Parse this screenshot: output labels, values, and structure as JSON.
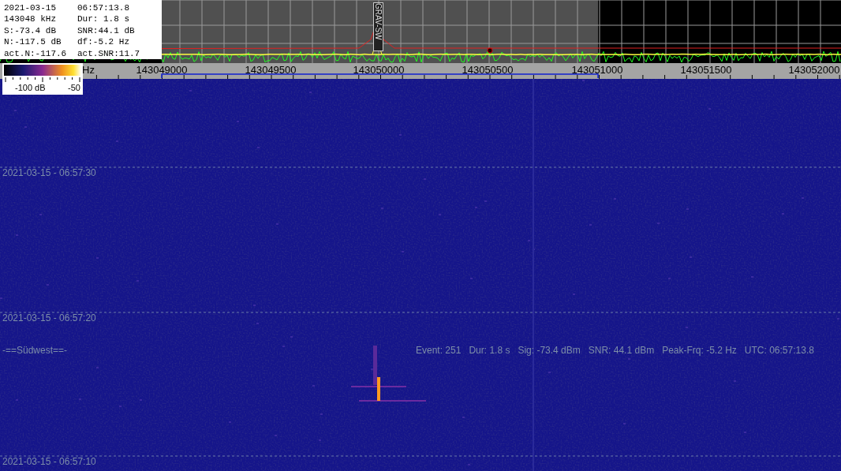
{
  "info": {
    "rows": [
      [
        "2021-03-15",
        "06:57:13.8"
      ],
      [
        "143048 kHz",
        "Dur: 1.8 s"
      ],
      [
        "S:-73.4 dB",
        "SNR:44.1 dB"
      ],
      [
        "N:-117.5 dB",
        "df:-5.2 Hz"
      ],
      [
        "act.N:-117.6",
        "act.SNR:11.7"
      ]
    ]
  },
  "legend": {
    "labels": [
      "-100 dB",
      "-50"
    ]
  },
  "spectrum": {
    "marker": "GRAV-SW"
  },
  "scale": {
    "unit": "Hz",
    "labels": [
      "143049000",
      "143049500",
      "143050000",
      "143050500",
      "143051000",
      "143051500",
      "143052000"
    ]
  },
  "waterfall": {
    "time_labels": [
      "2021-03-15 - 06:57:30",
      "2021-03-15 - 06:57:20",
      "2021-03-15 - 06:57:10"
    ],
    "station": "-==Südwest==-",
    "event": "Event: 251   Dur: 1.8 s   Sig: -73.4 dBm   SNR: 44.1 dBm   Peak-Frq: -5.2 Hz   UTC: 06:57:13.8"
  }
}
